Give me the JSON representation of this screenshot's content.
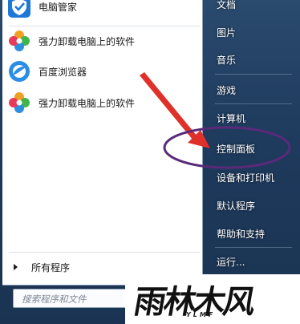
{
  "programs": [
    {
      "label": "电脑管家",
      "icon": "pc-manager-shield-icon"
    },
    {
      "label": "强力卸载电脑上的软件",
      "icon": "uninstaller-flower-icon"
    },
    {
      "label": "百度浏览器",
      "icon": "baidu-browser-icon"
    },
    {
      "label": "强力卸载电脑上的软件",
      "icon": "uninstaller-flower-icon"
    }
  ],
  "all_programs_label": "所有程序",
  "search": {
    "placeholder": "搜索程序和文件"
  },
  "right_menu": {
    "items": [
      "文档",
      "图片",
      "音乐",
      "游戏",
      "计算机",
      "控制面板",
      "设备和打印机",
      "默认程序",
      "帮助和支持",
      "运行..."
    ],
    "highlighted": "控制面板"
  },
  "watermark": {
    "main": "雨林木风",
    "sub": "YLMF"
  },
  "colors": {
    "menu_bg": "#1e3a5c",
    "left_pane_bg": "#ffffff",
    "annotation_arrow": "#e0302a",
    "annotation_ellipse": "#5a2a7a"
  }
}
